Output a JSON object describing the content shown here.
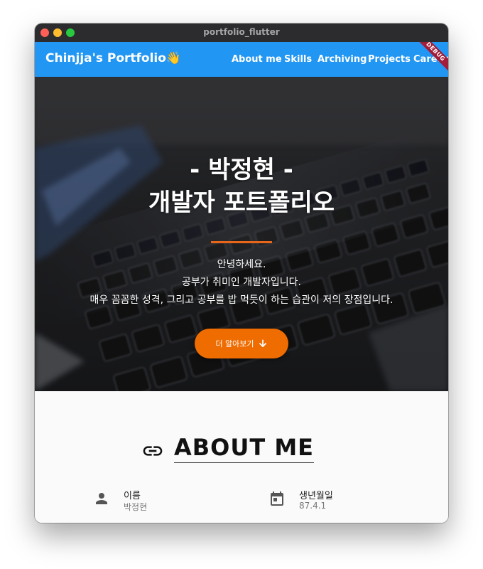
{
  "window": {
    "title": "portfolio_flutter"
  },
  "appbar": {
    "brand": "Chinjja's Portfolio👋",
    "color": "#2196f3",
    "nav": [
      "About me",
      "Skills",
      "Archiving",
      "Projects",
      "Career"
    ],
    "debug_label": "DEBUG"
  },
  "hero": {
    "title_line1": "- 박정현 -",
    "title_line2": "개발자 포트폴리오",
    "text_line1": "안녕하세요.",
    "text_line2": "공부가 취미인 개발자입니다.",
    "text_line3": "매우 꼼꼼한 성격, 그리고 공부를 밥 먹듯이 하는 습관이 저의 장점입니다.",
    "button_label": "더 알아보기",
    "button_icon": "arrow-down-icon",
    "accent": "#ef6c00"
  },
  "about": {
    "title": "ABOUT ME",
    "title_icon": "link-icon",
    "items": [
      {
        "icon": "person-icon",
        "label": "이름",
        "value": "박정현"
      },
      {
        "icon": "calendar-icon",
        "label": "생년월일",
        "value": "87.4.1"
      }
    ]
  }
}
